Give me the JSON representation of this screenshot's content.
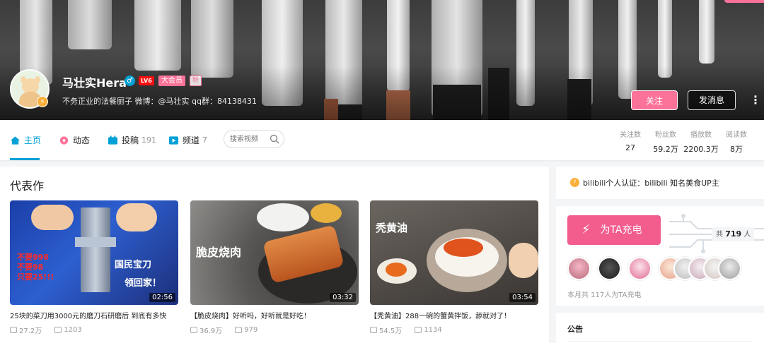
{
  "profile": {
    "name": "马壮实Hera",
    "gender_symbol": "♂",
    "level": "LV6",
    "vip": "大会员",
    "badge": "粉",
    "sign": "不务正业的法餐厨子 微博：@马壮实 qq群：84138431",
    "follow_label": "关注",
    "message_label": "发消息",
    "more_label": "⋮",
    "icons": [
      "avatar-illustration",
      "lightning-icon"
    ]
  },
  "nav": {
    "items": [
      {
        "label": "主页",
        "count": "",
        "icon": "home-icon"
      },
      {
        "label": "动态",
        "count": "",
        "icon": "moments-icon"
      },
      {
        "label": "投稿",
        "count": "191",
        "icon": "upload-icon"
      },
      {
        "label": "频道",
        "count": "7",
        "icon": "channel-icon"
      }
    ],
    "search_placeholder": "搜索视频",
    "accent": "#00a1d6"
  },
  "stats": [
    {
      "label": "关注数",
      "value": "27"
    },
    {
      "label": "粉丝数",
      "value": "59.2万"
    },
    {
      "label": "播放数",
      "value": "2200.3万"
    },
    {
      "label": "阅读数",
      "value": "8万"
    }
  ],
  "masterpieces": {
    "title": "代表作",
    "videos": [
      {
        "title": "25块的菜刀用3000元的磨刀石研磨后 到底有多快",
        "duration": "02:56",
        "plays": "27.2万",
        "danmaku": "1203",
        "thumb_texts": [
          "不要998",
          "不要98",
          "只要25!!!",
          "国民宝刀",
          "领回家！"
        ]
      },
      {
        "title": "【脆皮烧肉】好听吗，好听就是好吃！",
        "duration": "03:32",
        "plays": "36.9万",
        "danmaku": "979",
        "thumb_texts": [
          "脆皮烧肉"
        ]
      },
      {
        "title": "【秃黄油】288一碗的蟹黄拌饭，舔就对了！",
        "duration": "03:54",
        "plays": "54.5万",
        "danmaku": "1134",
        "thumb_texts": [
          "秃黄油"
        ]
      }
    ]
  },
  "sidebar": {
    "cert": "bilibili个人认证：bilibili 知名美食UP主",
    "charge_label": "为TA充电",
    "charge_total_prefix": "共",
    "charge_total": "719",
    "charge_total_suffix": "人",
    "charge_month": "本月共 117人为TA充电",
    "notice_title": "公告",
    "brand_pink": "#fb7299"
  }
}
